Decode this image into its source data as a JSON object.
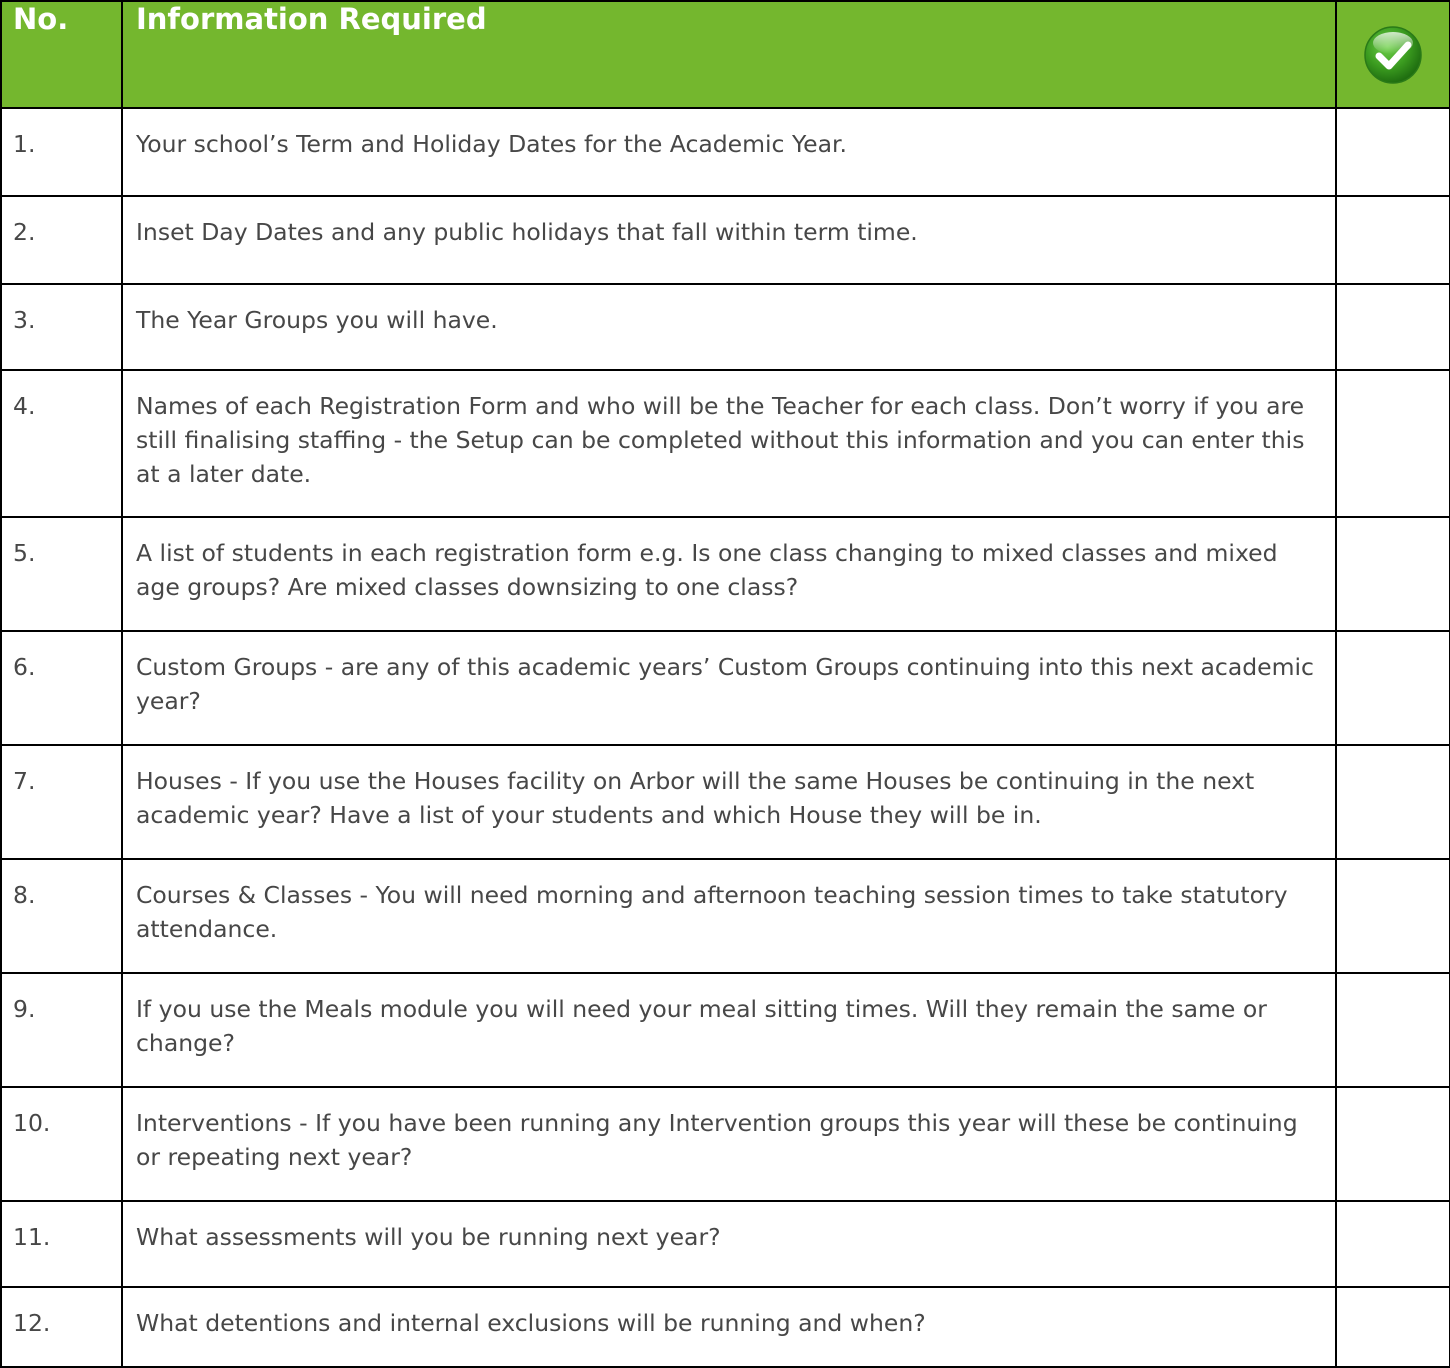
{
  "table": {
    "header": {
      "number_label": "No.",
      "info_label": "Information Required",
      "check_icon": "green-checkmark-badge-icon"
    },
    "colors": {
      "header_background": "#74b72e",
      "header_text": "#ffffff",
      "body_text": "#474747",
      "border": "#000000",
      "check_badge": "#3a9a1f"
    },
    "rows": [
      {
        "number": "1.",
        "text": "Your school’s Term and Holiday Dates for the Academic Year."
      },
      {
        "number": "2.",
        "text": "Inset Day Dates and any public holidays that fall within term time."
      },
      {
        "number": "3.",
        "text": "The Year Groups you will have."
      },
      {
        "number": "4.",
        "text": "Names of each Registration Form and who will be the Teacher for each class. Don’t worry if you are still finalising staffing - the Setup can be completed without this information and you can enter this at a later date."
      },
      {
        "number": "5.",
        "text": "A list of students in each registration form e.g. Is one class changing to mixed classes and mixed age groups? Are mixed classes downsizing to one class?"
      },
      {
        "number": "6.",
        "text": "Custom Groups - are any of this academic years’ Custom Groups continuing into this next academic year?"
      },
      {
        "number": "7.",
        "text": "Houses - If you use the Houses facility on Arbor will the same Houses be continuing in the next academic year? Have a list of your students and which House they will be in."
      },
      {
        "number": "8.",
        "text": "Courses & Classes - You will need morning and afternoon teaching session times to take statutory attendance."
      },
      {
        "number": "9.",
        "text": "If you use the Meals module you will need your meal sitting times. Will they remain the same or change?"
      },
      {
        "number": "10.",
        "text": "Interventions - If you have been running any Intervention groups this year will these be continuing or repeating next year?"
      },
      {
        "number": "11.",
        "text": "What assessments will you be running next year?"
      },
      {
        "number": "12.",
        "text": "What detentions and internal exclusions will be running and when?"
      }
    ]
  }
}
